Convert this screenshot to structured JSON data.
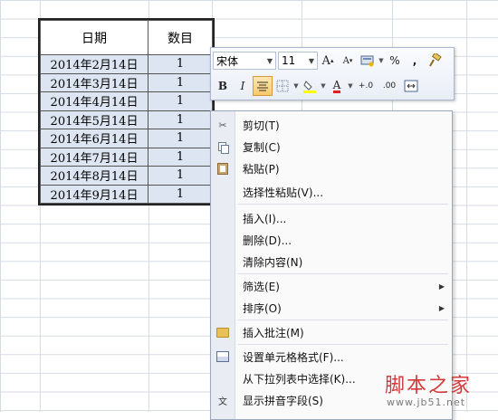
{
  "table": {
    "headers": [
      "日期",
      "数目"
    ],
    "rows": [
      {
        "date": "2014年2月14日",
        "count": "1"
      },
      {
        "date": "2014年3月14日",
        "count": "1"
      },
      {
        "date": "2014年4月14日",
        "count": "1"
      },
      {
        "date": "2014年5月14日",
        "count": "1"
      },
      {
        "date": "2014年6月14日",
        "count": "1"
      },
      {
        "date": "2014年7月14日",
        "count": "1"
      },
      {
        "date": "2014年8月14日",
        "count": "1"
      },
      {
        "date": "2014年9月14日",
        "count": "1"
      }
    ]
  },
  "mini_toolbar": {
    "font_name": "宋体",
    "font_size": "11",
    "grow_font": "A",
    "shrink_font": "A",
    "percent": "%",
    "comma": ",",
    "bold": "B",
    "italic": "I",
    "font_color_letter": "A",
    "increase_decimal": "+.0",
    "decrease_decimal": ".00",
    "accent_color": "#f7c86a",
    "font_color": "#e02020"
  },
  "context_menu": {
    "items": [
      {
        "label": "剪切(T)",
        "icon": "scissors-icon"
      },
      {
        "label": "复制(C)",
        "icon": "copy-icon"
      },
      {
        "label": "粘贴(P)",
        "icon": "paste-icon"
      },
      {
        "label": "选择性粘贴(V)...",
        "icon": ""
      },
      {
        "label": "插入(I)...",
        "icon": ""
      },
      {
        "label": "删除(D)...",
        "icon": ""
      },
      {
        "label": "清除内容(N)",
        "icon": ""
      },
      {
        "label": "筛选(E)",
        "icon": "",
        "submenu": true
      },
      {
        "label": "排序(O)",
        "icon": "",
        "submenu": true
      },
      {
        "label": "插入批注(M)",
        "icon": "comment-icon"
      },
      {
        "label": "设置单元格格式(F)...",
        "icon": "format-cells-icon"
      },
      {
        "label": "从下拉列表中选择(K)...",
        "icon": ""
      },
      {
        "label": "显示拼音字段(S)",
        "icon": "phonetic-icon"
      }
    ]
  },
  "watermark": {
    "title": "脚本之家",
    "url": "www.jb51.net"
  }
}
